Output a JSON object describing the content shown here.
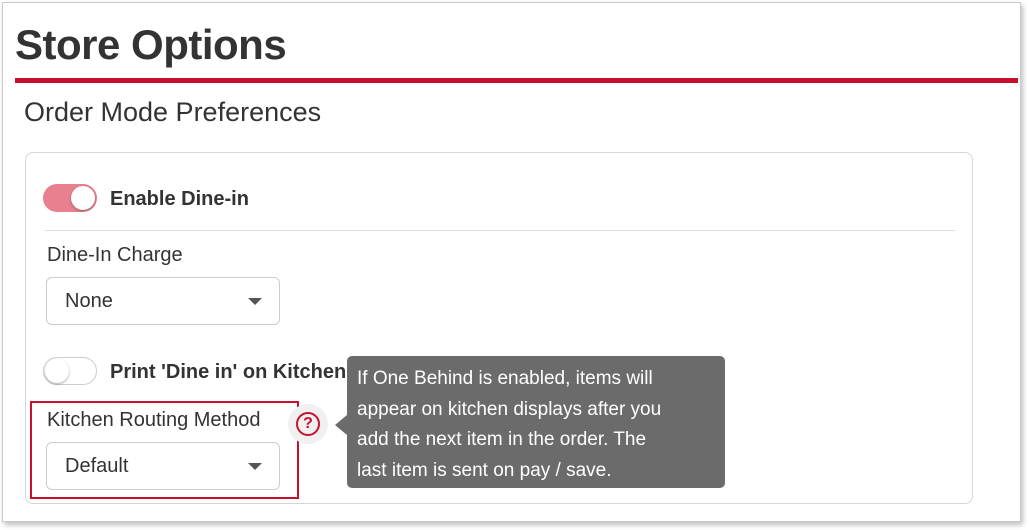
{
  "header": {
    "title": "Store Options",
    "accent_color": "#c8102e"
  },
  "section": {
    "title": "Order Mode Preferences"
  },
  "dine_in": {
    "toggle_label": "Enable Dine-in",
    "toggle_on": true,
    "charge_label": "Dine-In Charge",
    "charge_value": "None",
    "print_toggle_label": "Print 'Dine in' on Kitchen",
    "print_toggle_on": false,
    "routing_label": "Kitchen Routing Method",
    "routing_value": "Default"
  },
  "help": {
    "icon": "question-circle-icon",
    "glyph": "?",
    "tooltip_lines": [
      "If One Behind is enabled, items will",
      "appear on kitchen displays after you",
      "add the next item in the order. The",
      "last item is sent on pay / save."
    ]
  }
}
